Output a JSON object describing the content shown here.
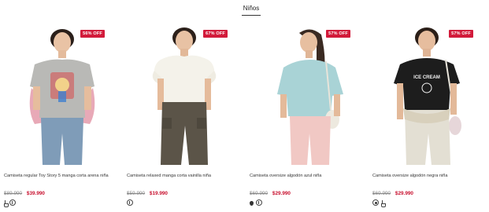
{
  "tabs": [
    {
      "label": "Niños",
      "active": true
    }
  ],
  "products": [
    {
      "discount_badge": "56% OFF",
      "title": "Camiseta regular Toy Story 5 manga corta arena niña",
      "old_price": "$89.990",
      "new_price": "$39.990",
      "icons": [
        "drop-icon",
        "hanger-circle-icon"
      ],
      "shirt_color": "#b9b9b6",
      "pants_color": "#7f9cb8"
    },
    {
      "discount_badge": "67% OFF",
      "title": "Camiseta relaxed manga corta vainilla niña",
      "old_price": "$59.990",
      "new_price": "$19.990",
      "icons": [
        "hanger-circle-icon"
      ],
      "shirt_color": "#f4f2ea",
      "pants_color": "#5b5448"
    },
    {
      "discount_badge": "57% OFF",
      "title": "Camiseta oversize algodón azul niña",
      "old_price": "$69.990",
      "new_price": "$29.990",
      "icons": [
        "drop-fill-icon",
        "hanger-circle-icon"
      ],
      "shirt_color": "#a9d3d6",
      "pants_color": "#f1c8c4"
    },
    {
      "discount_badge": "57% OFF",
      "title": "Camiseta oversize algodón negra niña",
      "old_price": "$69.990",
      "new_price": "$29.990",
      "icons": [
        "dot-circle-icon",
        "drop-icon"
      ],
      "shirt_color": "#1d1d1d",
      "pants_color": "#e3dfd3"
    }
  ],
  "colors": {
    "badge": "#d21a3a",
    "sale_price": "#c8102e"
  }
}
